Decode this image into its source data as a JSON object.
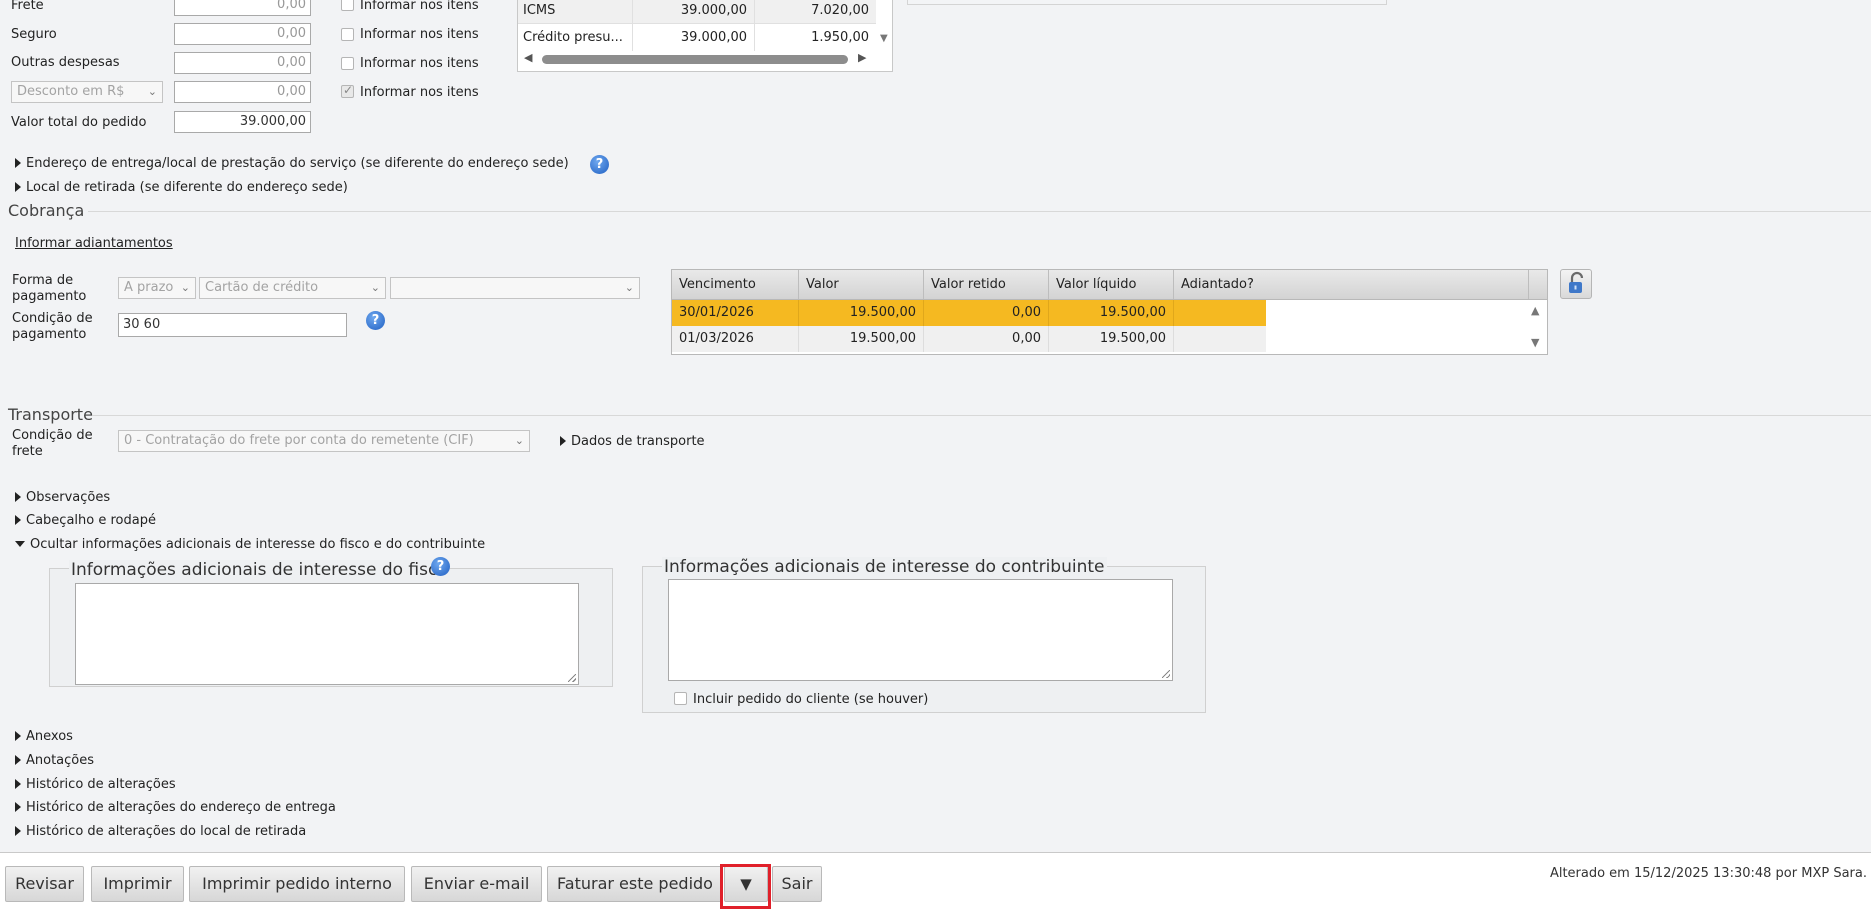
{
  "totals": {
    "frete_label": "Frete",
    "frete_value": "0,00",
    "seguro_label": "Seguro",
    "seguro_value": "0,00",
    "outras_label": "Outras despesas",
    "outras_value": "0,00",
    "desconto_select": "Desconto em R$",
    "desconto_value": "0,00",
    "total_label": "Valor total do pedido",
    "total_value": "39.000,00",
    "informar_itens": "Informar nos itens"
  },
  "tax_table": {
    "rows": [
      {
        "name": "ICMS",
        "base": "39.000,00",
        "value": "7.020,00"
      },
      {
        "name": "Crédito presu...",
        "base": "39.000,00",
        "value": "1.950,00"
      }
    ]
  },
  "links": {
    "endereco_entrega": "Endereço de entrega/local de prestação do serviço (se diferente do endereço sede)",
    "local_retirada": "Local de retirada (se diferente do endereço sede)"
  },
  "cobranca": {
    "title": "Cobrança",
    "informar_adiantamentos": "Informar adiantamentos",
    "forma_label": "Forma de pagamento",
    "forma_prazo": "A prazo",
    "forma_meio": "Cartão de crédito",
    "forma_extra": "",
    "condicao_label": "Condição de pagamento",
    "condicao_value": "30 60",
    "table": {
      "headers": [
        "Vencimento",
        "Valor",
        "Valor retido",
        "Valor líquido",
        "Adiantado?"
      ],
      "rows": [
        [
          "30/01/2026",
          "19.500,00",
          "0,00",
          "19.500,00",
          ""
        ],
        [
          "01/03/2026",
          "19.500,00",
          "0,00",
          "19.500,00",
          ""
        ]
      ]
    }
  },
  "transporte": {
    "title": "Transporte",
    "condicao_label": "Condição de frete",
    "condicao_value": "0 - Contratação do frete por conta do remetente (CIF)",
    "dados": "Dados de transporte"
  },
  "collapsibles": {
    "observacoes": "Observações",
    "cabecalho": "Cabeçalho e rodapé",
    "ocultar": "Ocultar informações adicionais de interesse do fisco e do contribuinte",
    "anexos": "Anexos",
    "anotacoes": "Anotações",
    "historico": "Histórico de alterações",
    "historico_endereco": "Histórico de alterações do endereço de entrega",
    "historico_retirada": "Histórico de alterações do local de retirada"
  },
  "info": {
    "fisco_title": "Informações adicionais de interesse do fisco",
    "contribuinte_title": "Informações adicionais de interesse do contribuinte",
    "incluir_pedido": "Incluir pedido do cliente (se houver)"
  },
  "buttons": {
    "revisar": "Revisar",
    "imprimir": "Imprimir",
    "imprimir_interno": "Imprimir pedido interno",
    "enviar_email": "Enviar e-mail",
    "faturar": "Faturar este pedido",
    "more": "▼",
    "sair": "Sair"
  },
  "footer": {
    "alterado": "Alterado em 15/12/2025 13:30:48 por MXP Sara."
  },
  "colors": {
    "highlight_row": "#f5b921",
    "focus_border": "#e0202a"
  }
}
